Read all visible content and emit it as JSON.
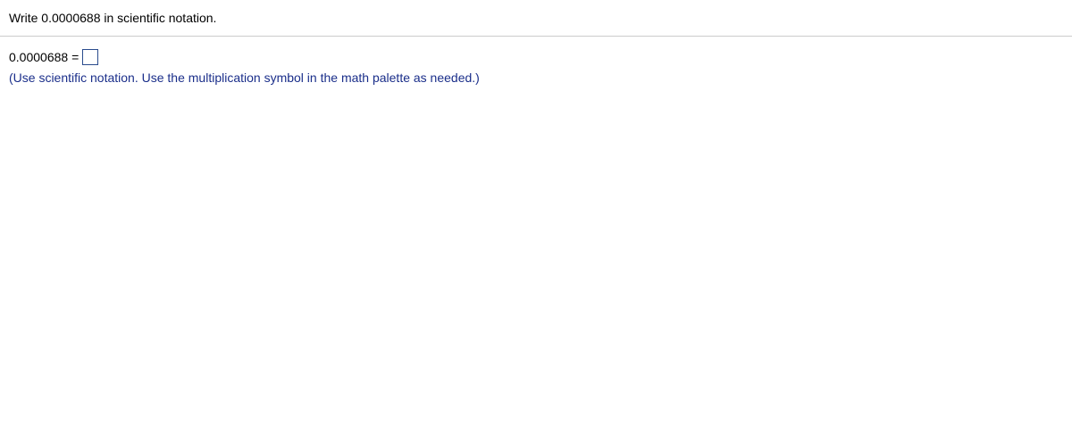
{
  "question": {
    "prompt": "Write 0.0000688 in scientific notation."
  },
  "answer": {
    "prefix": "0.0000688 =",
    "input_value": "",
    "hint": "(Use scientific notation. Use the multiplication symbol in the math palette as needed.)"
  }
}
